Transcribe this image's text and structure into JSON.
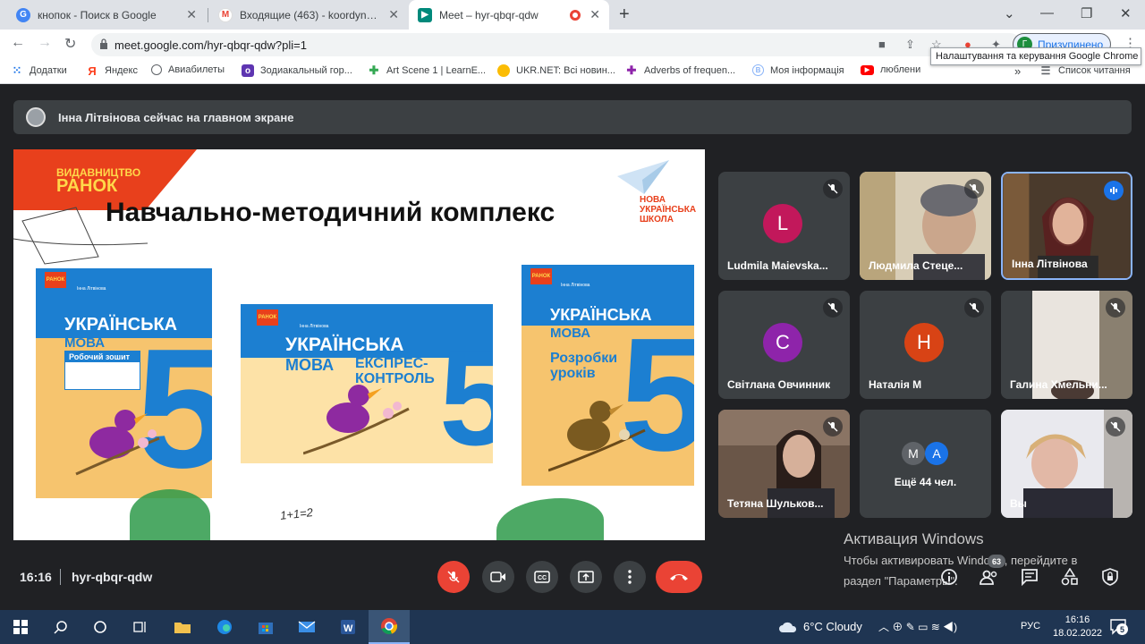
{
  "browser": {
    "tabs": [
      {
        "title": "кнопок - Поиск в Google",
        "icon": "google-icon",
        "active": false
      },
      {
        "title": "Входящие (463) - koordynatzia@",
        "icon": "gmail-icon",
        "active": false
      },
      {
        "title": "Meet – hyr-qbqr-qdw",
        "icon": "meet-icon",
        "active": true
      }
    ],
    "url": "meet.google.com/hyr-qbqr-qdw?pli=1",
    "profile_label": "Призупинено",
    "profile_initial": "Г",
    "tooltip": "Налаштування та керування Google Chrome",
    "bookmarks": [
      {
        "label": "Додатки",
        "icon": "apps-icon"
      },
      {
        "label": "Яндекс",
        "icon": "yandex-icon"
      },
      {
        "label": "Авиабилеты",
        "icon": "globe-icon"
      },
      {
        "label": "Зодиакальный гор...",
        "icon": "zodiac-icon"
      },
      {
        "label": "Art Scene 1 | LearnE...",
        "icon": "grid-icon"
      },
      {
        "label": "UKR.NET: Всі новин...",
        "icon": "ukrnet-icon"
      },
      {
        "label": "Adverbs of frequen...",
        "icon": "grid-icon"
      },
      {
        "label": "Моя інформація",
        "icon": "info-icon"
      },
      {
        "label": "люблени",
        "icon": "youtube-icon"
      }
    ],
    "reading_list": "Список читання",
    "overflow": "»"
  },
  "meet": {
    "presenting_banner": "Інна Літвінова сейчас на главном экране",
    "slide": {
      "publisher_label": "ВИДАВНИЦТВО",
      "publisher_name": "РАНОК",
      "heading": "Навчально-методичний комплекс",
      "series": "НОВА УКРАЇНСЬКА ШКОЛА",
      "handwriting": "1+1=2",
      "books": [
        {
          "logo": "РАНОК",
          "author": "Інна Літвінова",
          "title1": "УКРАЇНСЬКА",
          "title2": "МОВА",
          "subtitle": "Робочий зошит",
          "number": "5"
        },
        {
          "logo": "РАНОК",
          "author": "Інна Літвінова",
          "title1": "УКРАЇНСЬКА",
          "title2": "МОВА",
          "subtitle": "ЕКСПРЕС-КОНТРОЛЬ",
          "number": "5"
        },
        {
          "logo": "РАНОК",
          "author": "Інна Літвінова",
          "title1": "УКРАЇНСЬКА",
          "title2": "МОВА",
          "subtitle": "Розробки уроків",
          "number": "5"
        }
      ]
    },
    "participants": [
      {
        "name": "Ludmila Maievska...",
        "initial": "L",
        "color": "#c2185b",
        "type": "avatar"
      },
      {
        "name": "Людмила Стеце...",
        "type": "photo"
      },
      {
        "name": "Інна Літвінова",
        "type": "photo",
        "speaking": true
      },
      {
        "name": "Світлана Овчинник",
        "initial": "С",
        "color": "#8e24aa",
        "type": "avatar"
      },
      {
        "name": "Наталія М",
        "initial": "Н",
        "color": "#d84315",
        "type": "avatar"
      },
      {
        "name": "Галина Хмельни...",
        "type": "photo"
      },
      {
        "name": "Тетяна Шульков...",
        "type": "photo"
      },
      {
        "name": "Ещё 44 чел.",
        "initials": [
          "M",
          "A"
        ],
        "type": "more"
      },
      {
        "name": "Вы",
        "type": "photo"
      }
    ],
    "clock": "16:16",
    "meeting_code": "hyr-qbqr-qdw",
    "participant_count": "63",
    "watermark": {
      "title": "Активация Windows",
      "line1": "Чтобы активировать Windows, перейдите в",
      "line2": "раздел \"Параметры\"."
    }
  },
  "taskbar": {
    "weather": "6°C  Cloudy",
    "language": "РУС",
    "time": "16:16",
    "date": "18.02.2022",
    "notifications": "5"
  }
}
